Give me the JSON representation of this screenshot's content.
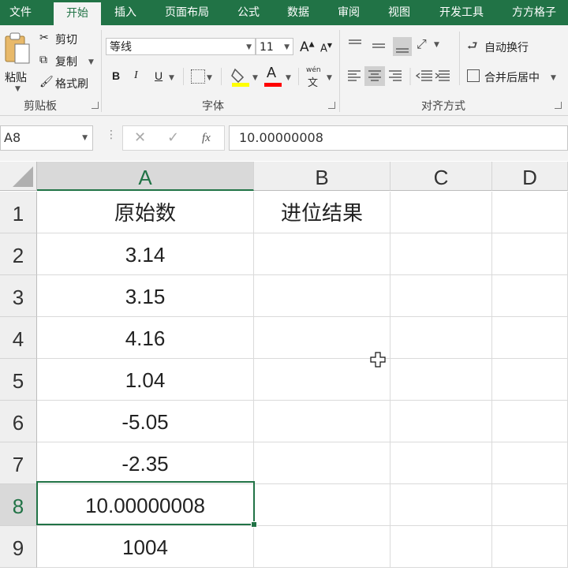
{
  "tabs": [
    "文件",
    "开始",
    "插入",
    "页面布局",
    "公式",
    "数据",
    "审阅",
    "视图",
    "开发工具",
    "方方格子"
  ],
  "active_tab": "开始",
  "clipboard": {
    "paste": "粘贴",
    "cut": "剪切",
    "copy": "复制",
    "format_painter": "格式刷",
    "group": "剪贴板"
  },
  "font": {
    "name": "等线",
    "size": "11",
    "bold": "B",
    "italic": "I",
    "underline": "U",
    "phonetic_top": "wén",
    "phonetic_bottom": "文",
    "group": "字体",
    "grow": "A",
    "shrink": "A"
  },
  "alignment": {
    "wrap": "自动换行",
    "merge": "合并后居中",
    "group": "对齐方式"
  },
  "formula_bar": {
    "name_box": "A8",
    "fx": "fx",
    "value": "10.00000008"
  },
  "columns": [
    "A",
    "B",
    "C",
    "D"
  ],
  "rows": [
    "1",
    "2",
    "3",
    "4",
    "5",
    "6",
    "7",
    "8",
    "9"
  ],
  "cells_A": [
    "原始数",
    "3.14",
    "3.15",
    "4.16",
    "1.04",
    "-5.05",
    "-2.35",
    "10.00000008",
    "1004"
  ],
  "cells_B": [
    "进位结果",
    "",
    "",
    "",
    "",
    "",
    "",
    "",
    ""
  ],
  "selected_cell": "A8",
  "colors": {
    "ribbon_green": "#217346",
    "selection_border": "#217346",
    "highlight": "#ffff00",
    "font_color": "#ff0000"
  }
}
